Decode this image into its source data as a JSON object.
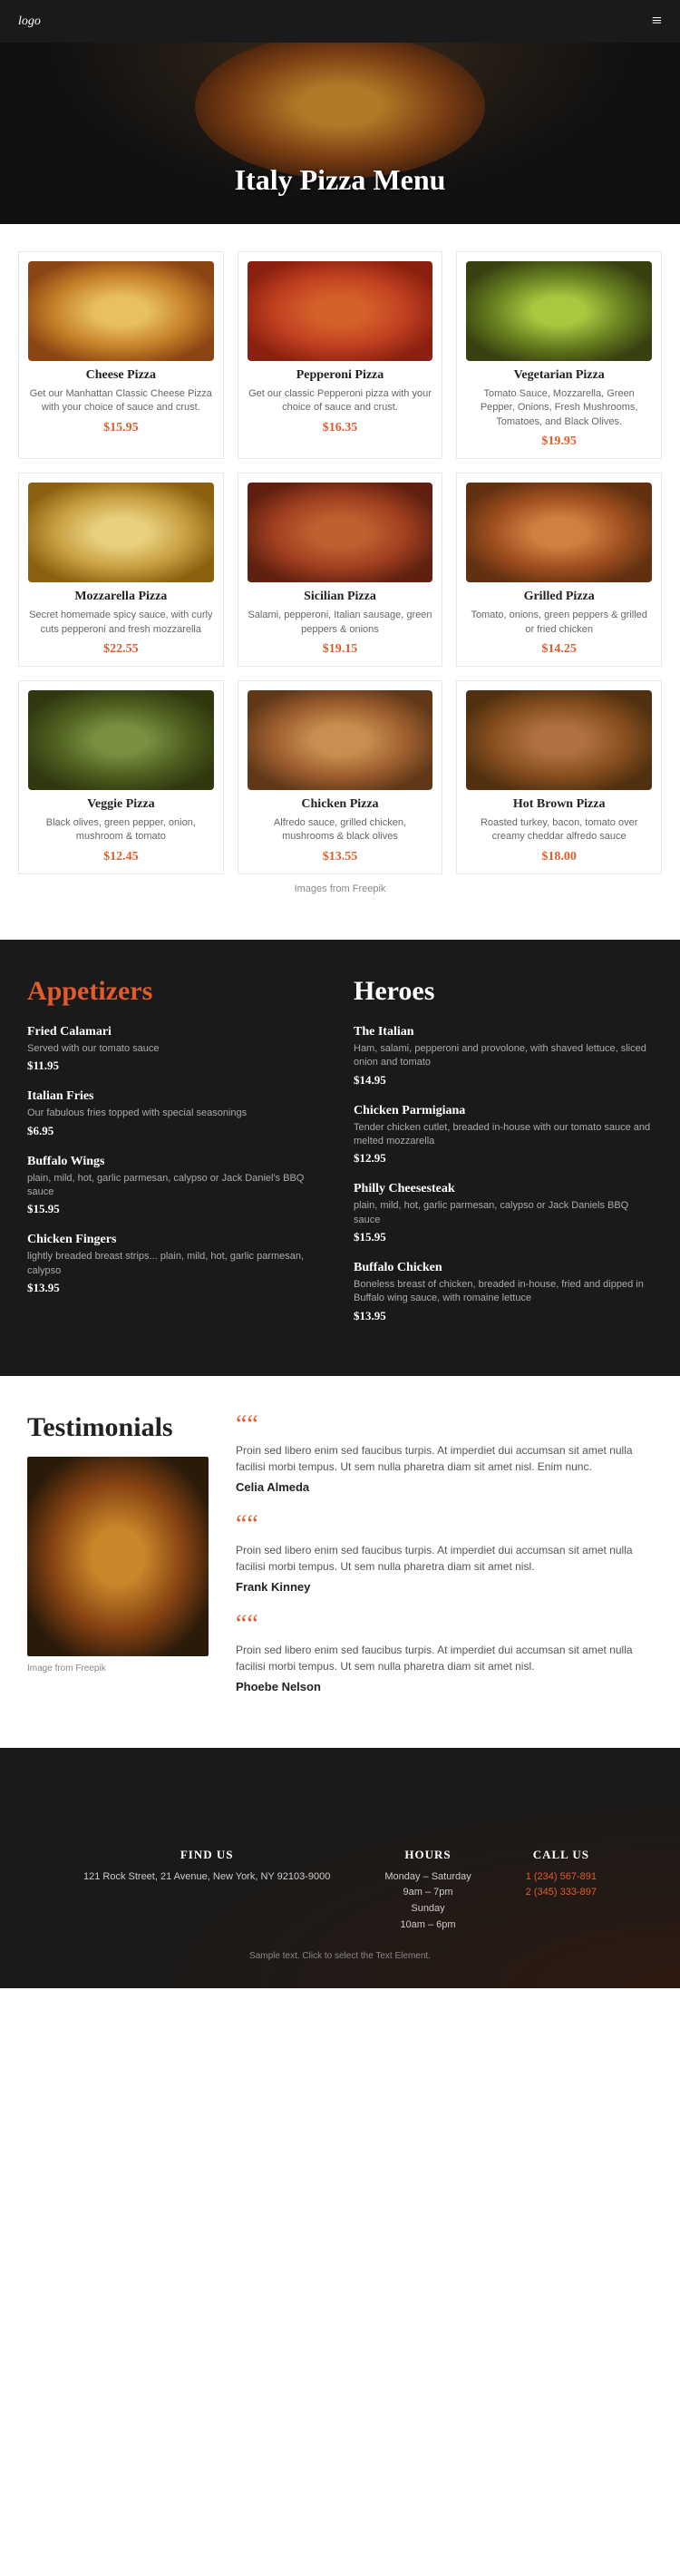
{
  "header": {
    "logo": "logo",
    "hamburger_icon": "≡"
  },
  "hero": {
    "title": "Italy Pizza Menu"
  },
  "pizzas": [
    {
      "name": "Cheese Pizza",
      "desc": "Get our Manhattan Classic Cheese Pizza with your choice of sauce and crust.",
      "price": "$15.95",
      "img_class": "img-cheese"
    },
    {
      "name": "Pepperoni Pizza",
      "desc": "Get our classic Pepperoni pizza with your choice of sauce and crust.",
      "price": "$16.35",
      "img_class": "img-pepperoni"
    },
    {
      "name": "Vegetarian Pizza",
      "desc": "Tomato Sauce, Mozzarella, Green Pepper, Onions, Fresh Mushrooms, Tomatoes, and Black Olives.",
      "price": "$19.95",
      "img_class": "img-vegetarian"
    },
    {
      "name": "Mozzarella Pizza",
      "desc": "Secret homemade spicy sauce, with curly cuts pepperoni and fresh mozzarella",
      "price": "$22.55",
      "img_class": "img-mozzarella"
    },
    {
      "name": "Sicilian Pizza",
      "desc": "Salami, pepperoni, Italian sausage, green peppers & onions",
      "price": "$19.15",
      "img_class": "img-sicilian"
    },
    {
      "name": "Grilled Pizza",
      "desc": "Tomato, onions, green peppers & grilled or fried chicken",
      "price": "$14.25",
      "img_class": "img-grilled"
    },
    {
      "name": "Veggie Pizza",
      "desc": "Black olives, green pepper, onion, mushroom & tomato",
      "price": "$12.45",
      "img_class": "img-veggie"
    },
    {
      "name": "Chicken Pizza",
      "desc": "Alfredo sauce, grilled chicken, mushrooms & black olives",
      "price": "$13.55",
      "img_class": "img-chicken"
    },
    {
      "name": "Hot Brown Pizza",
      "desc": "Roasted turkey, bacon, tomato over creamy cheddar alfredo sauce",
      "price": "$18.00",
      "img_class": "img-hotbrown"
    }
  ],
  "freepik_note": "Images from Freepik",
  "appetizers": {
    "heading": "Appetizers",
    "items": [
      {
        "name": "Fried Calamari",
        "desc": "Served with our tomato sauce",
        "price": "$11.95"
      },
      {
        "name": "Italian Fries",
        "desc": "Our fabulous fries topped with special seasonings",
        "price": "$6.95"
      },
      {
        "name": "Buffalo Wings",
        "desc": "plain, mild, hot, garlic parmesan, calypso or Jack Daniel's BBQ sauce",
        "price": "$15.95"
      },
      {
        "name": "Chicken Fingers",
        "desc": "lightly breaded breast strips... plain, mild, hot, garlic parmesan, calypso",
        "price": "$13.95"
      }
    ]
  },
  "heroes": {
    "heading": "Heroes",
    "items": [
      {
        "name": "The Italian",
        "desc": "Ham, salami, pepperoni and provolone, with shaved lettuce, sliced onion and tomato",
        "price": "$14.95"
      },
      {
        "name": "Chicken Parmigiana",
        "desc": "Tender chicken cutlet, breaded in-house with our tomato sauce and melted mozzarella",
        "price": "$12.95"
      },
      {
        "name": "Philly Cheesesteak",
        "desc": "plain, mild, hot, garlic parmesan, calypso or Jack Daniels BBQ sauce",
        "price": "$15.95"
      },
      {
        "name": "Buffalo Chicken",
        "desc": "Boneless breast of chicken, breaded in-house, fried and dipped in Buffalo wing sauce, with romaine lettuce",
        "price": "$13.95"
      }
    ]
  },
  "testimonials": {
    "heading": "Testimonials",
    "img_note": "Image from Freepik",
    "items": [
      {
        "quote": "Proin sed libero enim sed faucibus turpis. At imperdiet dui accumsan sit amet nulla facilisi morbi tempus. Ut sem nulla pharetra diam sit amet nisl. Enim nunc.",
        "name": "Celia Almeda"
      },
      {
        "quote": "Proin sed libero enim sed faucibus turpis. At imperdiet dui accumsan sit amet nulla facilisi morbi tempus. Ut sem nulla pharetra diam sit amet nisl.",
        "name": "Frank Kinney"
      },
      {
        "quote": "Proin sed libero enim sed faucibus turpis. At imperdiet dui accumsan sit amet nulla facilisi morbi tempus. Ut sem nulla pharetra diam sit amet nisl.",
        "name": "Phoebe Nelson"
      }
    ]
  },
  "footer": {
    "find_us_label": "FIND US",
    "find_us_text": "121 Rock Street, 21 Avenue, New York, NY 92103-9000",
    "hours_label": "HOURS",
    "hours_text": "Monday – Saturday\n9am – 7pm\nSunday\n10am – 6pm",
    "call_us_label": "CALL US",
    "phone1": "1 (234) 567-891",
    "phone2": "2 (345) 333-897",
    "sample_note": "Sample text. Click to select the Text Element."
  }
}
